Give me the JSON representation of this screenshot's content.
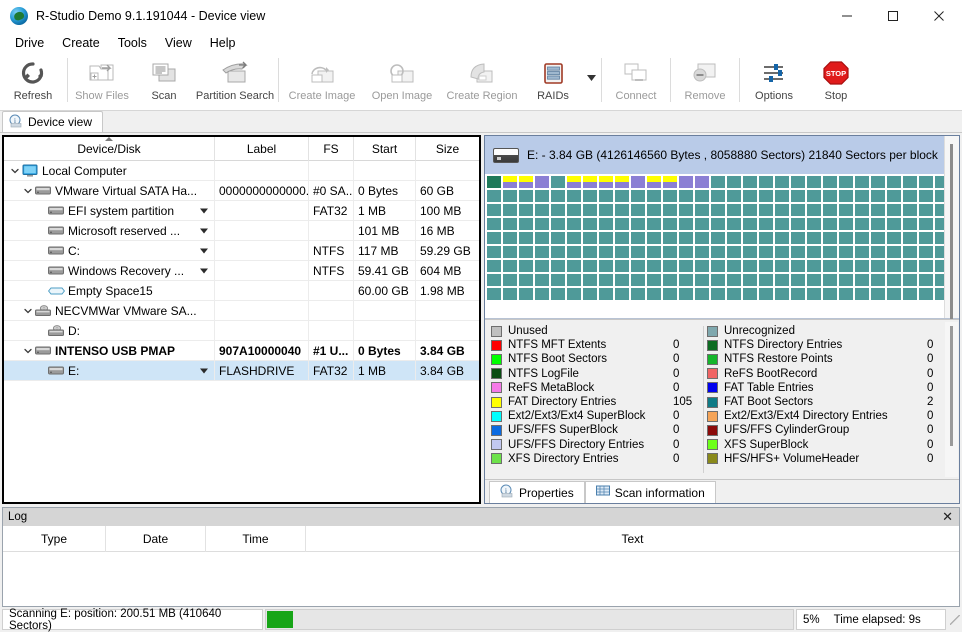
{
  "window": {
    "title": "R-Studio Demo 9.1.191044 - Device view",
    "app_icon": "rstudio-logo-icon",
    "minimize": "minimize-icon",
    "maximize": "maximize-icon",
    "close": "close-icon"
  },
  "menu": {
    "items": [
      {
        "label": "Drive"
      },
      {
        "label": "Create"
      },
      {
        "label": "Tools"
      },
      {
        "label": "View"
      },
      {
        "label": "Help"
      }
    ]
  },
  "toolbar": {
    "buttons": [
      {
        "label": "Refresh",
        "icon": "refresh-icon",
        "disabled": false
      },
      {
        "label": "Show Files",
        "icon": "show-files-icon",
        "disabled": true
      },
      {
        "label": "Scan",
        "icon": "scan-icon",
        "disabled": false
      },
      {
        "label": "Partition Search",
        "icon": "partition-search-icon",
        "disabled": false
      },
      {
        "label": "Create Image",
        "icon": "create-image-icon",
        "disabled": true
      },
      {
        "label": "Open Image",
        "icon": "open-image-icon",
        "disabled": true
      },
      {
        "label": "Create Region",
        "icon": "create-region-icon",
        "disabled": true
      },
      {
        "label": "RAIDs",
        "icon": "raids-icon",
        "disabled": false
      },
      {
        "label": "Connect",
        "icon": "connect-icon",
        "disabled": true
      },
      {
        "label": "Remove",
        "icon": "remove-icon",
        "disabled": true
      },
      {
        "label": "Options",
        "icon": "options-icon",
        "disabled": false
      },
      {
        "label": "Stop",
        "icon": "stop-icon",
        "disabled": false
      }
    ],
    "raids_dropdown": "chevron-down-icon"
  },
  "tabstrip": {
    "tab_label": "Device view",
    "tab_icon": "info-icon"
  },
  "tree": {
    "columns": [
      "Device/Disk",
      "Label",
      "FS",
      "Start",
      "Size"
    ],
    "sorted_column": "Device/Disk",
    "rows": [
      {
        "name": "Local Computer",
        "label": "",
        "fs": "",
        "start": "",
        "size": "",
        "indent": 0,
        "chevron": "down",
        "icon": "computer-icon",
        "caret": false,
        "bold": false,
        "selected": false
      },
      {
        "name": "VMware Virtual SATA Ha...",
        "label": "0000000000000...",
        "fs": "#0 SA...",
        "start": "0 Bytes",
        "size": "60 GB",
        "indent": 1,
        "chevron": "down",
        "icon": "disk-icon",
        "caret": false,
        "bold": false,
        "selected": false
      },
      {
        "name": "EFI system partition",
        "label": "",
        "fs": "FAT32",
        "start": "1 MB",
        "size": "100 MB",
        "indent": 2,
        "chevron": "none",
        "icon": "partition-icon",
        "caret": true,
        "bold": false,
        "selected": false
      },
      {
        "name": "Microsoft reserved ...",
        "label": "",
        "fs": "",
        "start": "101 MB",
        "size": "16 MB",
        "indent": 2,
        "chevron": "none",
        "icon": "partition-icon",
        "caret": true,
        "bold": false,
        "selected": false
      },
      {
        "name": "C:",
        "label": "",
        "fs": "NTFS",
        "start": "117 MB",
        "size": "59.29 GB",
        "indent": 2,
        "chevron": "none",
        "icon": "partition-icon",
        "caret": true,
        "bold": false,
        "selected": false
      },
      {
        "name": "Windows Recovery ...",
        "label": "",
        "fs": "NTFS",
        "start": "59.41 GB",
        "size": "604 MB",
        "indent": 2,
        "chevron": "none",
        "icon": "partition-icon",
        "caret": true,
        "bold": false,
        "selected": false
      },
      {
        "name": "Empty Space15",
        "label": "",
        "fs": "",
        "start": "60.00 GB",
        "size": "1.98 MB",
        "indent": 2,
        "chevron": "none",
        "icon": "empty-space-icon",
        "caret": false,
        "bold": false,
        "selected": false
      },
      {
        "name": "NECVMWar VMware SA...",
        "label": "",
        "fs": "",
        "start": "",
        "size": "",
        "indent": 1,
        "chevron": "down",
        "icon": "cdrom-icon",
        "caret": false,
        "bold": false,
        "selected": false
      },
      {
        "name": "D:",
        "label": "",
        "fs": "",
        "start": "",
        "size": "",
        "indent": 2,
        "chevron": "none",
        "icon": "cdrom-icon",
        "caret": false,
        "bold": false,
        "selected": false
      },
      {
        "name": "INTENSO USB PMAP",
        "label": "907A10000040",
        "fs": "#1 U...",
        "start": "0 Bytes",
        "size": "3.84 GB",
        "indent": 1,
        "chevron": "down",
        "icon": "disk-icon",
        "caret": false,
        "bold": true,
        "selected": false
      },
      {
        "name": "E:",
        "label": "FLASHDRIVE",
        "fs": "FAT32",
        "start": "1 MB",
        "size": "3.84 GB",
        "indent": 2,
        "chevron": "none",
        "icon": "partition-icon",
        "caret": true,
        "bold": false,
        "selected": true
      }
    ]
  },
  "device_map": {
    "header": "E: - 3.84 GB (4126146560 Bytes , 8058880 Sectors) 21840 Sectors per block",
    "header_icon": "disk-icon",
    "unused_color": "#4f9a99",
    "block_colors": [
      "#1f7a5a",
      "#ffff00",
      "#ffff00",
      "#8b7fd4",
      "#4f9a99",
      "#ffff00",
      "#ffff00",
      "#ffff00",
      "#ffff00",
      "#8b7fd4",
      "#ffff00",
      "#ffff00",
      "#8b7fd4",
      "#8b7fd4"
    ],
    "block_colors_row2": [
      "#1f7a5a",
      "#8b7fd4",
      "#8b7fd4",
      "#8b7fd4",
      "#4f9a99",
      "#8b7fd4",
      "#8b7fd4",
      "#8b7fd4",
      "#8b7fd4",
      "#8b7fd4",
      "#8b7fd4",
      "#8b7fd4",
      "#8b7fd4",
      "#8b7fd4"
    ],
    "columns": 31,
    "rows": 9
  },
  "legend": {
    "left": [
      {
        "name": "Unused",
        "value": "",
        "color": "#c0c0c0"
      },
      {
        "name": "NTFS MFT Extents",
        "value": "0",
        "color": "#ff0000"
      },
      {
        "name": "NTFS Boot Sectors",
        "value": "0",
        "color": "#00ff00"
      },
      {
        "name": "NTFS LogFile",
        "value": "0",
        "color": "#0a4d12"
      },
      {
        "name": "ReFS MetaBlock",
        "value": "0",
        "color": "#f57ae8"
      },
      {
        "name": "FAT Directory Entries",
        "value": "105",
        "color": "#ffff00"
      },
      {
        "name": "Ext2/Ext3/Ext4 SuperBlock",
        "value": "0",
        "color": "#00ffff"
      },
      {
        "name": "UFS/FFS SuperBlock",
        "value": "0",
        "color": "#0a6ae0"
      },
      {
        "name": "UFS/FFS Directory Entries",
        "value": "0",
        "color": "#c2c8f0"
      },
      {
        "name": "XFS Directory Entries",
        "value": "0",
        "color": "#6de24a"
      }
    ],
    "right": [
      {
        "name": "Unrecognized",
        "value": "",
        "color": "#7fa8ae"
      },
      {
        "name": "NTFS Directory Entries",
        "value": "0",
        "color": "#0d6b22"
      },
      {
        "name": "NTFS Restore Points",
        "value": "0",
        "color": "#15b52b"
      },
      {
        "name": "ReFS BootRecord",
        "value": "0",
        "color": "#f06464"
      },
      {
        "name": "FAT Table Entries",
        "value": "0",
        "color": "#0000ee"
      },
      {
        "name": "FAT Boot Sectors",
        "value": "2",
        "color": "#0f7b86"
      },
      {
        "name": "Ext2/Ext3/Ext4 Directory Entries",
        "value": "0",
        "color": "#f5a458"
      },
      {
        "name": "UFS/FFS CylinderGroup",
        "value": "0",
        "color": "#8b0a0a"
      },
      {
        "name": "XFS SuperBlock",
        "value": "0",
        "color": "#6dff1a"
      },
      {
        "name": "HFS/HFS+ VolumeHeader",
        "value": "0",
        "color": "#8a8a1b"
      }
    ]
  },
  "right_tabs": [
    {
      "label": "Properties",
      "icon": "info-icon",
      "active": false
    },
    {
      "label": "Scan information",
      "icon": "grid-icon",
      "active": true
    }
  ],
  "log": {
    "title": "Log",
    "close_icon": "close-icon",
    "columns": [
      "Type",
      "Date",
      "Time",
      "Text"
    ],
    "rows": []
  },
  "status": {
    "message": "Scanning E: position: 200.51 MB (410640 Sectors)",
    "progress_percent": 5,
    "progress_label": "5%",
    "time_elapsed": "Time elapsed: 9s",
    "progress_color": "#17a517"
  }
}
